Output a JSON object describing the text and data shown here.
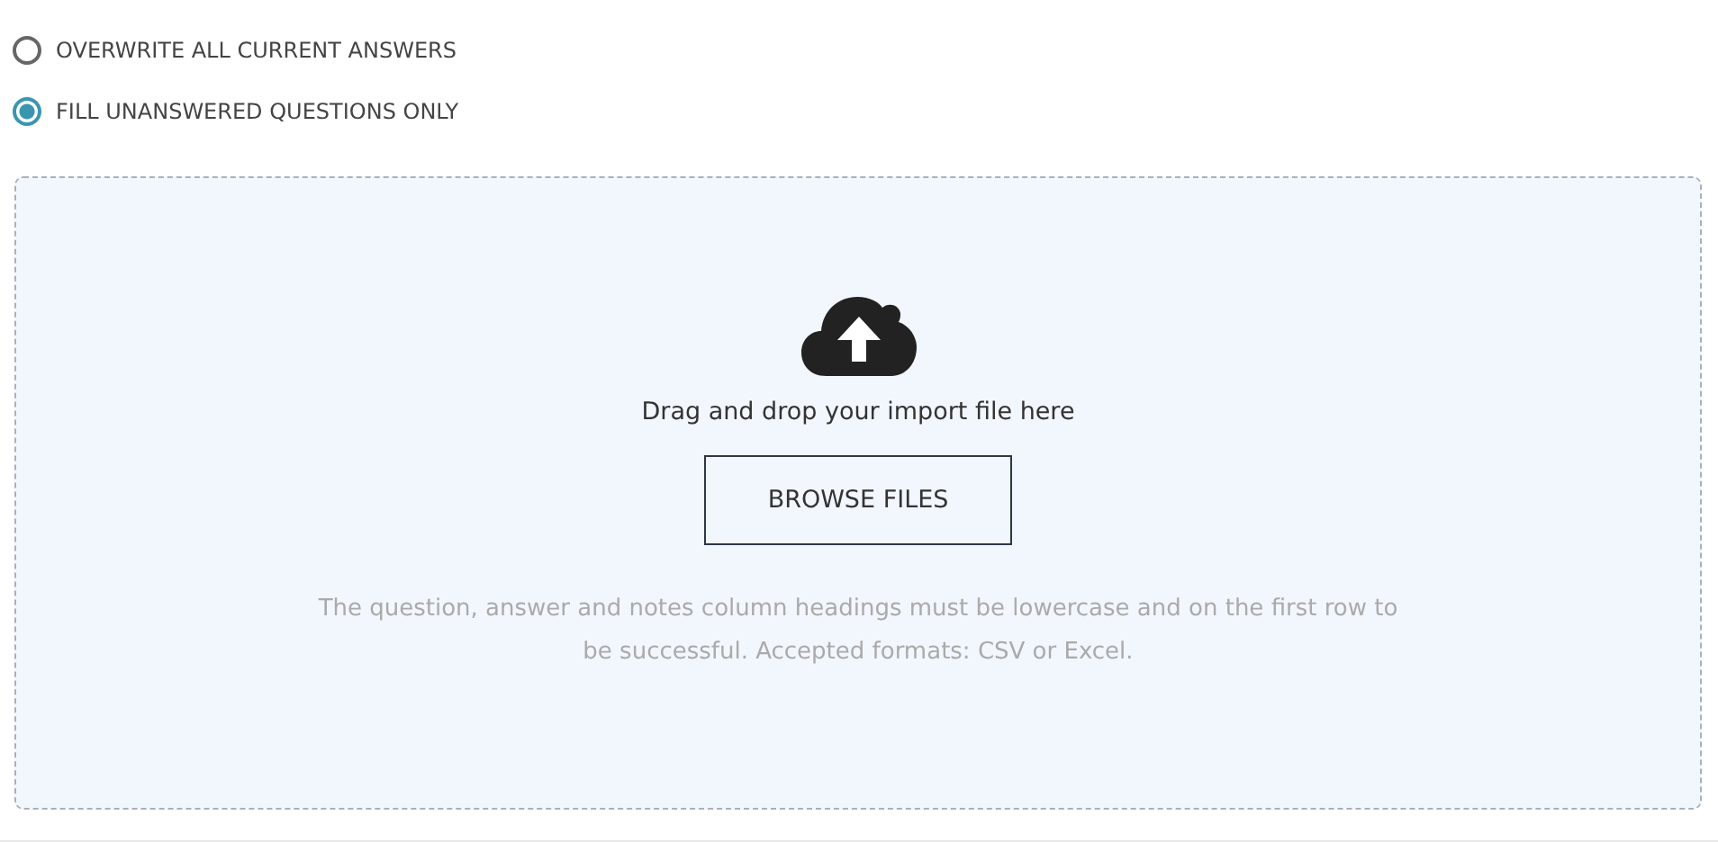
{
  "import_mode": [
    {
      "label": "OVERWRITE ALL CURRENT ANSWERS",
      "selected": false
    },
    {
      "label": "FILL UNANSWERED QUESTIONS ONLY",
      "selected": true
    }
  ],
  "dropzone": {
    "prompt": "Drag and drop your import file here",
    "button": "BROWSE FILES",
    "hint": "The question, answer and notes column headings must be lowercase and on the first row to be successful. Accepted formats: CSV or Excel."
  }
}
